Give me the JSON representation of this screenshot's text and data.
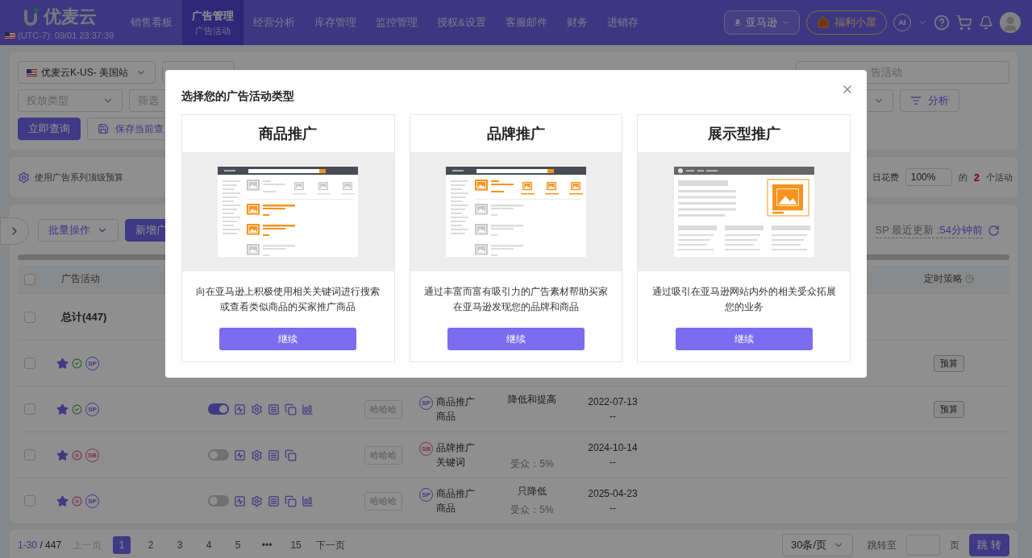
{
  "header": {
    "logo": "优麦云",
    "clock": "(UTC-7): 09/01 23:37:39",
    "nav": [
      {
        "label": "销售看板",
        "selected": false
      },
      {
        "label": "广告管理",
        "sub": "广告活动",
        "selected": true
      },
      {
        "label": "经营分析",
        "selected": false
      },
      {
        "label": "库存管理",
        "selected": false
      },
      {
        "label": "监控管理",
        "selected": false
      },
      {
        "label": "授权&设置",
        "selected": false
      },
      {
        "label": "客服邮件",
        "selected": false
      },
      {
        "label": "财务",
        "selected": false
      },
      {
        "label": "进销存",
        "selected": false
      }
    ],
    "marketplace": "亚马逊",
    "welfare": "福利小屋",
    "ai": "AI"
  },
  "filters": {
    "store": "优麦云K-US- 美国站",
    "search_placeholder": "告活动",
    "delivery_placeholder": "投放类型",
    "condition_placeholder": "筛选",
    "analyze": "分析",
    "query": "立即查询",
    "save": "保存当前查"
  },
  "budget": {
    "label": "使用广告系列顶级预算",
    "spend_label": "日花费",
    "percent": "100%",
    "of": "的",
    "count": "2",
    "unit": "个活动"
  },
  "table": {
    "bulk": "批量操作",
    "add": "新增广",
    "update_label": "SP 最近更新 :",
    "update_time": "54分钟前",
    "columns": [
      "广告活动",
      "定时策略"
    ],
    "header_checked": false,
    "total": "总计(447)",
    "total_checked": false,
    "rows": [
      {
        "checked": false,
        "starred": true,
        "active": true,
        "ad_type": "SP",
        "budget": "预算"
      },
      {
        "checked": false,
        "starred": true,
        "active": true,
        "ad_type": "SP",
        "enabled": true,
        "actions": [
          {
            "kind": "trend"
          },
          {
            "kind": "gear"
          },
          {
            "kind": "doc"
          },
          {
            "kind": "copy"
          },
          {
            "kind": "report"
          }
        ],
        "tag": "哈哈哈",
        "type_badge": "SP",
        "type": "商品推广",
        "target": "商品",
        "strategy": "降低和提高",
        "date": "2022-07-13",
        "date_end": "--",
        "budget": "预算"
      },
      {
        "checked": false,
        "starred": true,
        "active": false,
        "ad_type": "SB",
        "enabled": false,
        "actions": [
          {
            "kind": "trend"
          },
          {
            "kind": "gear"
          },
          {
            "kind": "doc"
          },
          {
            "kind": "copy"
          }
        ],
        "tag": "哈哈哈",
        "type_badge": "SB",
        "type": "品牌推广",
        "target": "关键词",
        "audience": "受众：5%",
        "date": "2024-10-14",
        "date_end": "--"
      },
      {
        "checked": false,
        "starred": true,
        "active": false,
        "ad_type": "SP",
        "enabled": false,
        "actions": [
          {
            "kind": "trend"
          },
          {
            "kind": "gear"
          },
          {
            "kind": "doc"
          },
          {
            "kind": "copy"
          },
          {
            "kind": "report"
          }
        ],
        "tag": "哈哈哈",
        "type_badge": "SP",
        "type": "商品推广",
        "target": "商品",
        "strategy": "只降低",
        "audience": "受众：5%",
        "date": "2025-04-23",
        "date_end": "--"
      }
    ]
  },
  "pagination": {
    "range": "1-30",
    "total": "/ 447",
    "prev": "上一页",
    "pages": [
      {
        "label": "1",
        "selected": true
      },
      {
        "label": "2",
        "selected": false
      },
      {
        "label": "3",
        "selected": false
      },
      {
        "label": "4",
        "selected": false
      },
      {
        "label": "5",
        "selected": false
      },
      {
        "label": "•••",
        "selected": false
      },
      {
        "label": "15",
        "selected": false
      }
    ],
    "next": "下一页",
    "page_size": "30条/页",
    "jump_label": "跳转至",
    "page_unit": "页",
    "jump_button": "跳 转"
  },
  "modal": {
    "title": "选择您的广告活动类型",
    "cards": [
      {
        "title": "商品推广",
        "kind": "products",
        "description": "向在亚马逊上积极使用相关关键词进行搜索或查看类似商品的买家推广商品",
        "button": "继续"
      },
      {
        "title": "品牌推广",
        "kind": "brand",
        "description": "通过丰富而富有吸引力的广告素材帮助买家在亚马逊发现您的品牌和商品",
        "button": "继续"
      },
      {
        "title": "展示型推广",
        "kind": "display",
        "description": "通过吸引在亚马逊网站内外的相关受众拓展您的业务",
        "button": "继续"
      }
    ]
  }
}
